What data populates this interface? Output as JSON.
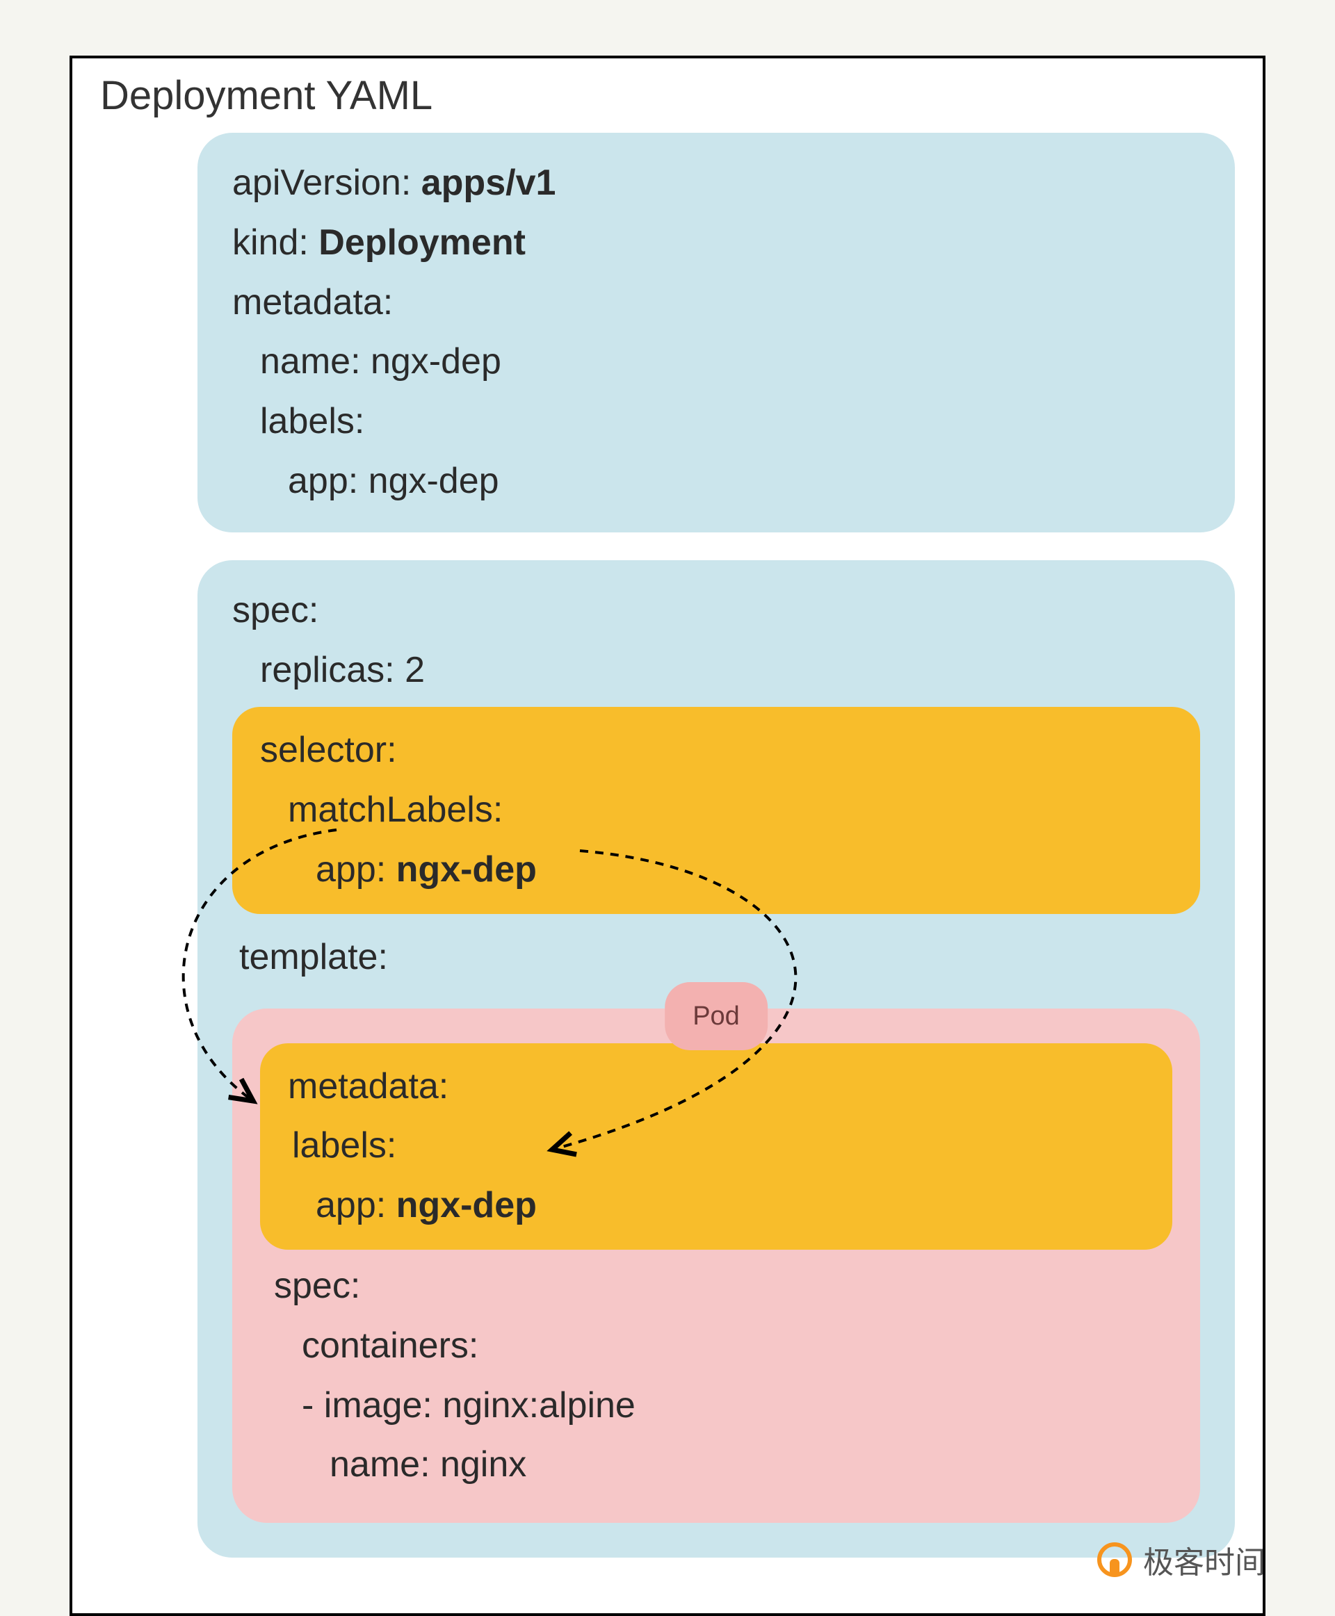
{
  "title": "Deployment YAML",
  "pod_badge": "Pod",
  "watermark": "极客时间",
  "header": {
    "apiVersion_key": "apiVersion:",
    "apiVersion_val": "apps/v1",
    "kind_key": "kind:",
    "kind_val": "Deployment",
    "metadata_key": "metadata:",
    "name_line": "name: ngx-dep",
    "labels_key": "labels:",
    "labels_app": "app: ngx-dep"
  },
  "spec": {
    "spec_key": "spec:",
    "replicas_line": "replicas: 2",
    "selector": {
      "selector_key": "selector:",
      "matchLabels_key": "matchLabels:",
      "app_key": "app:",
      "app_val": "ngx-dep"
    },
    "template_key": "template:",
    "template": {
      "metadata_key": "metadata:",
      "labels_key": "labels:",
      "app_key": "app:",
      "app_val": "ngx-dep",
      "spec_key": "spec:",
      "containers_key": "containers:",
      "image_line": "- image: nginx:alpine",
      "name_line": "name: nginx"
    }
  },
  "colors": {
    "blue": "#cbe5ec",
    "orange": "#f8bd2b",
    "pink": "#f6c7c8",
    "badge": "#f3b1b0"
  }
}
